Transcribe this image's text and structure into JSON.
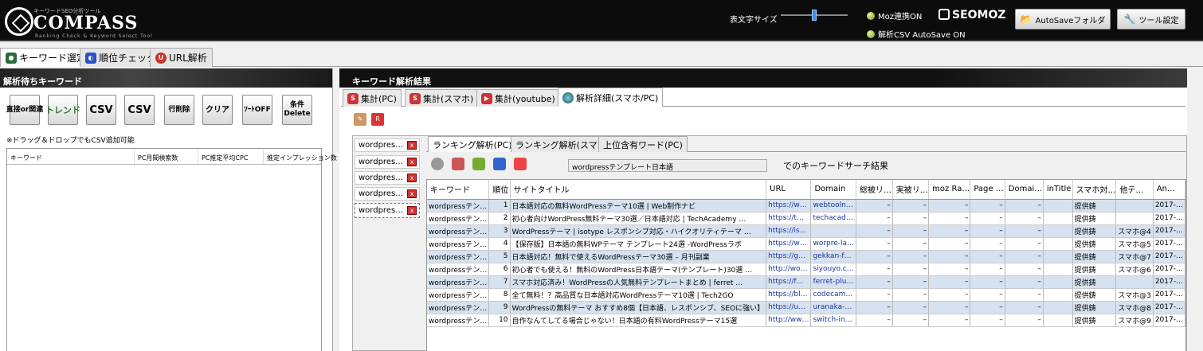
{
  "header": {
    "logo_sub": "キーワードSEO分析ツール",
    "logo_main": "COMPASS",
    "logo_tagline": "Ranking Check & Keyword Select Tool",
    "font_size_label": "表文字サイズ",
    "font_size_value": 0.5,
    "moz_status": "Moz連携ON",
    "csv_autosave_status": "解析CSV AutoSave ON",
    "seomoz": "SEOMOZ",
    "autosave_folder_button": "AutoSaveフォルダ",
    "tool_settings_button": "ツール設定"
  },
  "top_tabs": [
    {
      "label": "キーワード選定",
      "active": true
    },
    {
      "label": "順位チェック",
      "active": false
    },
    {
      "label": "URL解析",
      "active": false
    }
  ],
  "left_panel": {
    "title": "解析待ちキーワード",
    "buttons": [
      {
        "name": "related",
        "label": "直接or関連"
      },
      {
        "name": "trend",
        "label": "トレンド"
      },
      {
        "name": "csv-import",
        "label": "CSV"
      },
      {
        "name": "csv-export",
        "label": "CSV"
      },
      {
        "name": "delete-row",
        "label": "行削除"
      },
      {
        "name": "clear",
        "label": "クリア"
      },
      {
        "name": "sort-off",
        "label": "ｿｰﾄOFF"
      },
      {
        "name": "condition-delete",
        "label": "条件Delete"
      }
    ],
    "drop_note": "※ドラッグ＆ドロップでもCSV追加可能",
    "columns": [
      "キーワード",
      "PC月間検索数",
      "PC推定平均CPC",
      "推定インプレッション数"
    ]
  },
  "right_panel": {
    "title": "キーワード解析結果",
    "sub_tabs": [
      {
        "label": "集計(PC)",
        "active": false
      },
      {
        "label": "集計(スマホ)",
        "active": false
      },
      {
        "label": "集計(youtube)",
        "active": false
      },
      {
        "label": "解析詳細(スマホ/PC)",
        "active": true
      }
    ],
    "keyword_tabs": [
      "wordpres…",
      "wordpres…",
      "wordpres…",
      "wordpres…",
      "wordpres…"
    ],
    "ranking_tabs": [
      {
        "label": "ランキング解析(PC)",
        "active": true
      },
      {
        "label": "ランキング解析(スマホ)",
        "active": false
      },
      {
        "label": "上位含有ワード(PC)",
        "active": false
      }
    ],
    "query": "wordpressテンプレート日本語",
    "search_label": "でのキーワードサーチ結果",
    "table": {
      "columns": [
        "キーワード",
        "順位",
        "サイトタイトル",
        "URL",
        "Domain",
        "総被リ…",
        "実被リ…",
        "moz Ra…",
        "Page …",
        "Domai…",
        "inTitle",
        "スマホ対…",
        "他テ…",
        "An…"
      ],
      "rows": [
        [
          "wordpressテン…",
          "1",
          "日本語対応の無料WordPressテーマ10選 | Web制作ナビ",
          "https://w…",
          "webtooln…",
          "–",
          "–",
          "–",
          "–",
          "–",
          "",
          "提供鋳",
          "",
          "2017-…"
        ],
        [
          "wordpressテン…",
          "2",
          "初心者向けWordPress無料テーマ30選／日本語対応 | TechAcademy …",
          "https://t…",
          "techacad…",
          "–",
          "–",
          "–",
          "–",
          "–",
          "",
          "提供鋳",
          "",
          "2017-…"
        ],
        [
          "wordpressテン…",
          "3",
          "WordPressテーマ | isotype レスポンシブ対応・ハイクオリティテーマ …",
          "https://is…",
          "",
          "–",
          "–",
          "–",
          "–",
          "–",
          "",
          "提供鋳",
          "スマホ@4",
          "2017-…"
        ],
        [
          "wordpressテン…",
          "4",
          "【保存版】日本語の無料WPテーマ テンプレート24選 -WordPressラボ",
          "https://w…",
          "worpre-la…",
          "–",
          "–",
          "–",
          "–",
          "–",
          "",
          "提供鋳",
          "スマホ@5",
          "2017-…"
        ],
        [
          "wordpressテン…",
          "5",
          "日本語対応！無料で使えるWordPressテーマ30選 – 月刊副業",
          "https://g…",
          "gekkan-f…",
          "–",
          "–",
          "–",
          "–",
          "–",
          "",
          "提供鋳",
          "スマホ@7",
          "2017-…"
        ],
        [
          "wordpressテン…",
          "6",
          "初心者でも使える！無料のWordPress日本語テーマ(テンプレート)30選 …",
          "http://wo…",
          "siyouyo.c…",
          "–",
          "–",
          "–",
          "–",
          "–",
          "",
          "提供鋳",
          "スマホ@6",
          "2017-…"
        ],
        [
          "wordpressテン…",
          "7",
          "スマホ対応済み！WordPressの人気無料テンプレートまとめ | ferret …",
          "https://f…",
          "ferret-plu…",
          "–",
          "–",
          "–",
          "–",
          "–",
          "",
          "提供鋳",
          "",
          "2017-…"
        ],
        [
          "wordpressテン…",
          "8",
          "全て無料！？高品質な日本語対応WordPressテーマ10選 | Tech2GO",
          "https://bl…",
          "codecam…",
          "–",
          "–",
          "–",
          "–",
          "–",
          "",
          "提供鋳",
          "スマホ@3",
          "2017-…"
        ],
        [
          "wordpressテン…",
          "9",
          "WordPressの無料テーマ おすすめ8個【日本語、レスポンシブ、SEOに強い】",
          "https://u…",
          "uranaka-…",
          "–",
          "–",
          "–",
          "–",
          "–",
          "",
          "提供鋳",
          "スマホ@8",
          "2017-…"
        ],
        [
          "wordpressテン…",
          "10",
          "自作なんてしてる場合じゃない！日本語の有料WordPressテーマ15選",
          "http://ww…",
          "switch-in…",
          "–",
          "–",
          "–",
          "–",
          "–",
          "",
          "提供鋳",
          "スマホ@9",
          "2017-…"
        ]
      ]
    }
  },
  "colors": {
    "accent": "#3c8de0",
    "row_alt": "#d6e2ef",
    "header_bg": "#0c0c0c"
  }
}
